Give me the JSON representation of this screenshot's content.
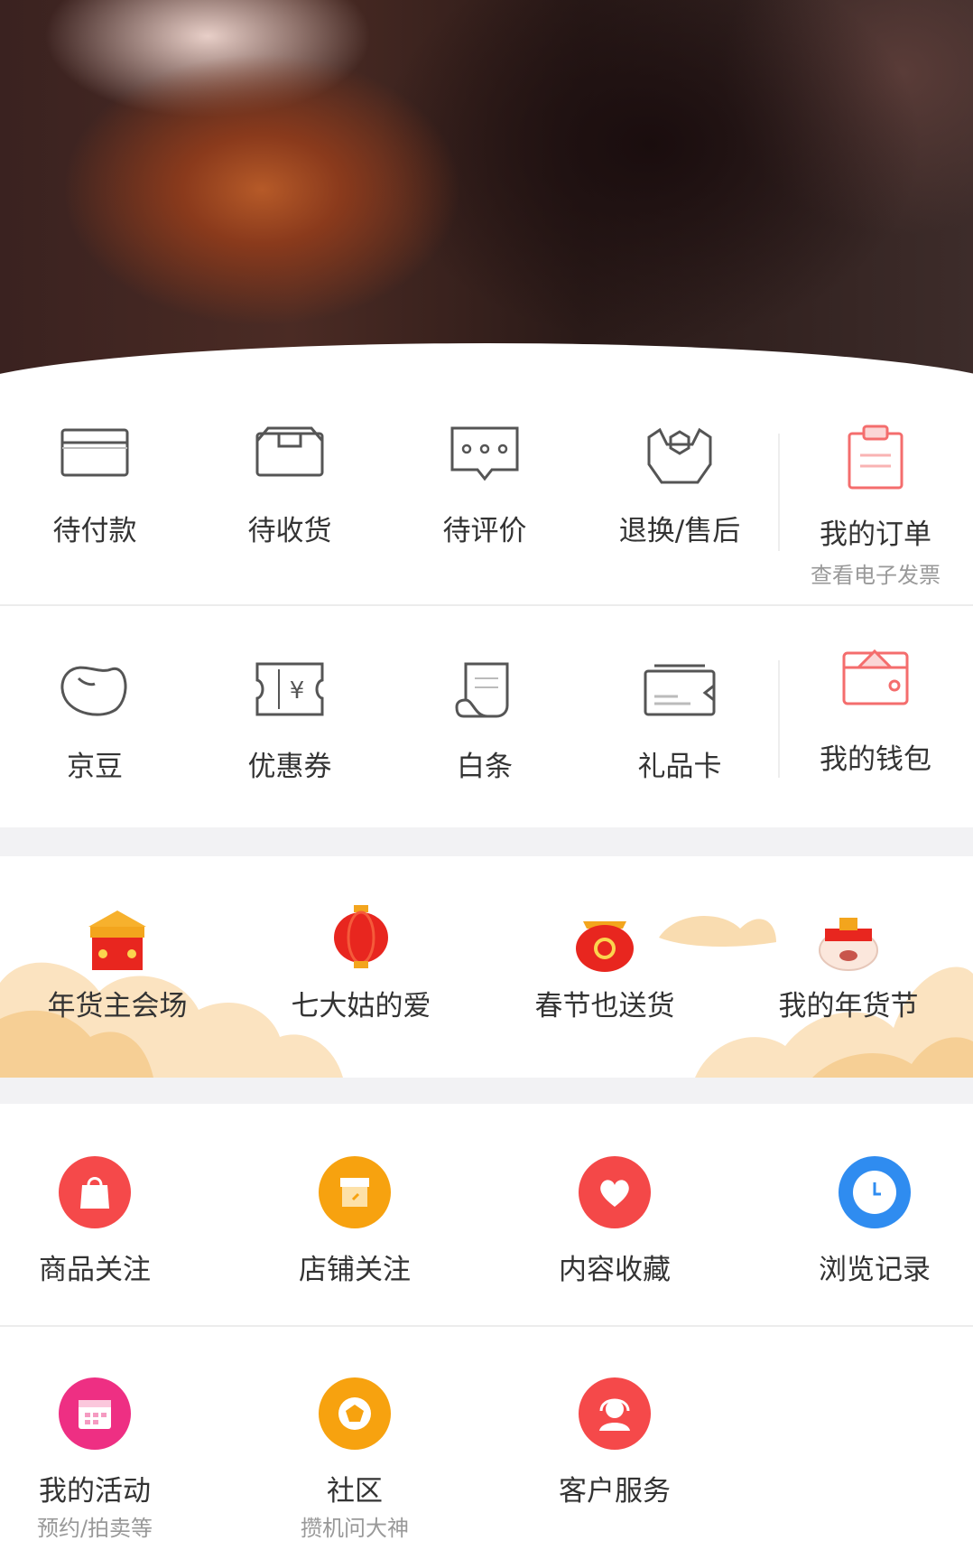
{
  "orders": {
    "items": [
      {
        "label": "待付款",
        "icon": "card-icon"
      },
      {
        "label": "待收货",
        "icon": "box-icon"
      },
      {
        "label": "待评价",
        "icon": "comment-icon"
      },
      {
        "label": "退换/售后",
        "icon": "wrench-icon"
      }
    ],
    "main": {
      "label": "我的订单",
      "sub": "查看电子发票",
      "icon": "clipboard-icon"
    }
  },
  "wallet": {
    "items": [
      {
        "label": "京豆",
        "icon": "bean-icon"
      },
      {
        "label": "优惠券",
        "icon": "coupon-icon"
      },
      {
        "label": "白条",
        "icon": "scroll-icon"
      },
      {
        "label": "礼品卡",
        "icon": "gift-card-icon"
      }
    ],
    "main": {
      "label": "我的钱包",
      "icon": "wallet-icon"
    }
  },
  "festival": {
    "items": [
      {
        "label": "年货主会场",
        "icon": "festival-palace-icon"
      },
      {
        "label": "七大姑的爱",
        "icon": "lantern-icon"
      },
      {
        "label": "春节也送货",
        "icon": "lucky-bag-icon"
      },
      {
        "label": "我的年货节",
        "icon": "dog-mascot-icon"
      }
    ]
  },
  "follows": {
    "items": [
      {
        "label": "商品关注",
        "icon": "shopping-bag-icon",
        "color": "#f5494a"
      },
      {
        "label": "店铺关注",
        "icon": "store-icon",
        "color": "#f7a20f"
      },
      {
        "label": "内容收藏",
        "icon": "heart-icon",
        "color": "#f44848"
      },
      {
        "label": "浏览记录",
        "icon": "clock-icon",
        "color": "#2f8cf0"
      }
    ]
  },
  "services": {
    "items": [
      {
        "label": "我的活动",
        "sub": "预约/拍卖等",
        "icon": "calendar-icon",
        "color": "#ee2f83"
      },
      {
        "label": "社区",
        "sub": "攒机问大神",
        "icon": "community-icon",
        "color": "#f7a20f"
      },
      {
        "label": "客户服务",
        "sub": "",
        "icon": "headset-icon",
        "color": "#f5494a"
      }
    ]
  }
}
